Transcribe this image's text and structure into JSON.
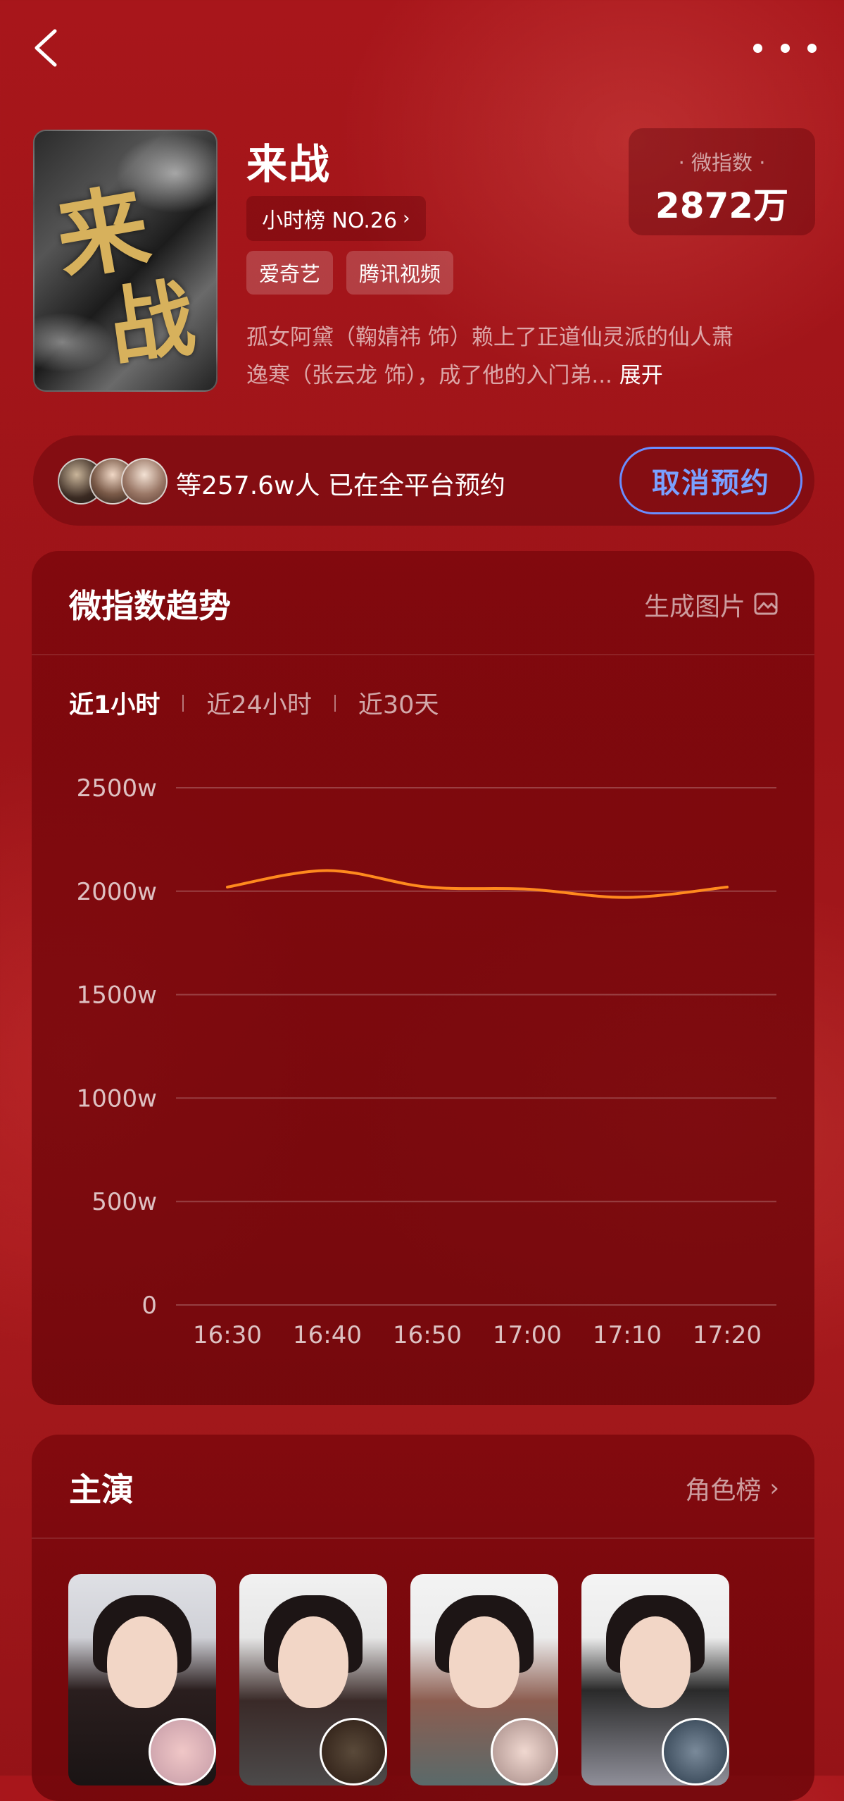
{
  "header": {
    "back_icon": "chevron-left-icon",
    "more_icon": "more-horizontal-icon"
  },
  "drama": {
    "poster_text": [
      "来",
      "战"
    ],
    "title": "来战",
    "rank_label": "小时榜 NO.26",
    "platforms": [
      "爱奇艺",
      "腾讯视频"
    ],
    "synopsis_line1": "孤女阿黛（鞠婧祎 饰）赖上了正道仙灵派的仙人萧",
    "synopsis_line2": "逸寒（张云龙 饰），成了他的入门弟...",
    "expand_label": "展开",
    "index_label": "· 微指数 ·",
    "index_value": "2872万"
  },
  "reservation": {
    "text": "等257.6w人 已在全平台预约",
    "button_label": "取消预约",
    "button_color": "#6a8dff"
  },
  "trend": {
    "title": "微指数趋势",
    "action_label": "生成图片",
    "tabs": [
      "近1小时",
      "近24小时",
      "近30天"
    ],
    "active_tab": 0
  },
  "chart_data": {
    "type": "line",
    "x": [
      "16:30",
      "16:40",
      "16:50",
      "17:00",
      "17:10",
      "17:20"
    ],
    "series": [
      {
        "values": [
          2020,
          2100,
          2020,
          2010,
          1970,
          2020
        ],
        "color": "#ff8a1e"
      }
    ],
    "y_ticks": [
      "0",
      "500w",
      "1000w",
      "1500w",
      "2000w",
      "2500w"
    ],
    "ylim": [
      0,
      2500
    ],
    "grid": true
  },
  "cast": {
    "title": "主演",
    "action_label": "角色榜"
  }
}
